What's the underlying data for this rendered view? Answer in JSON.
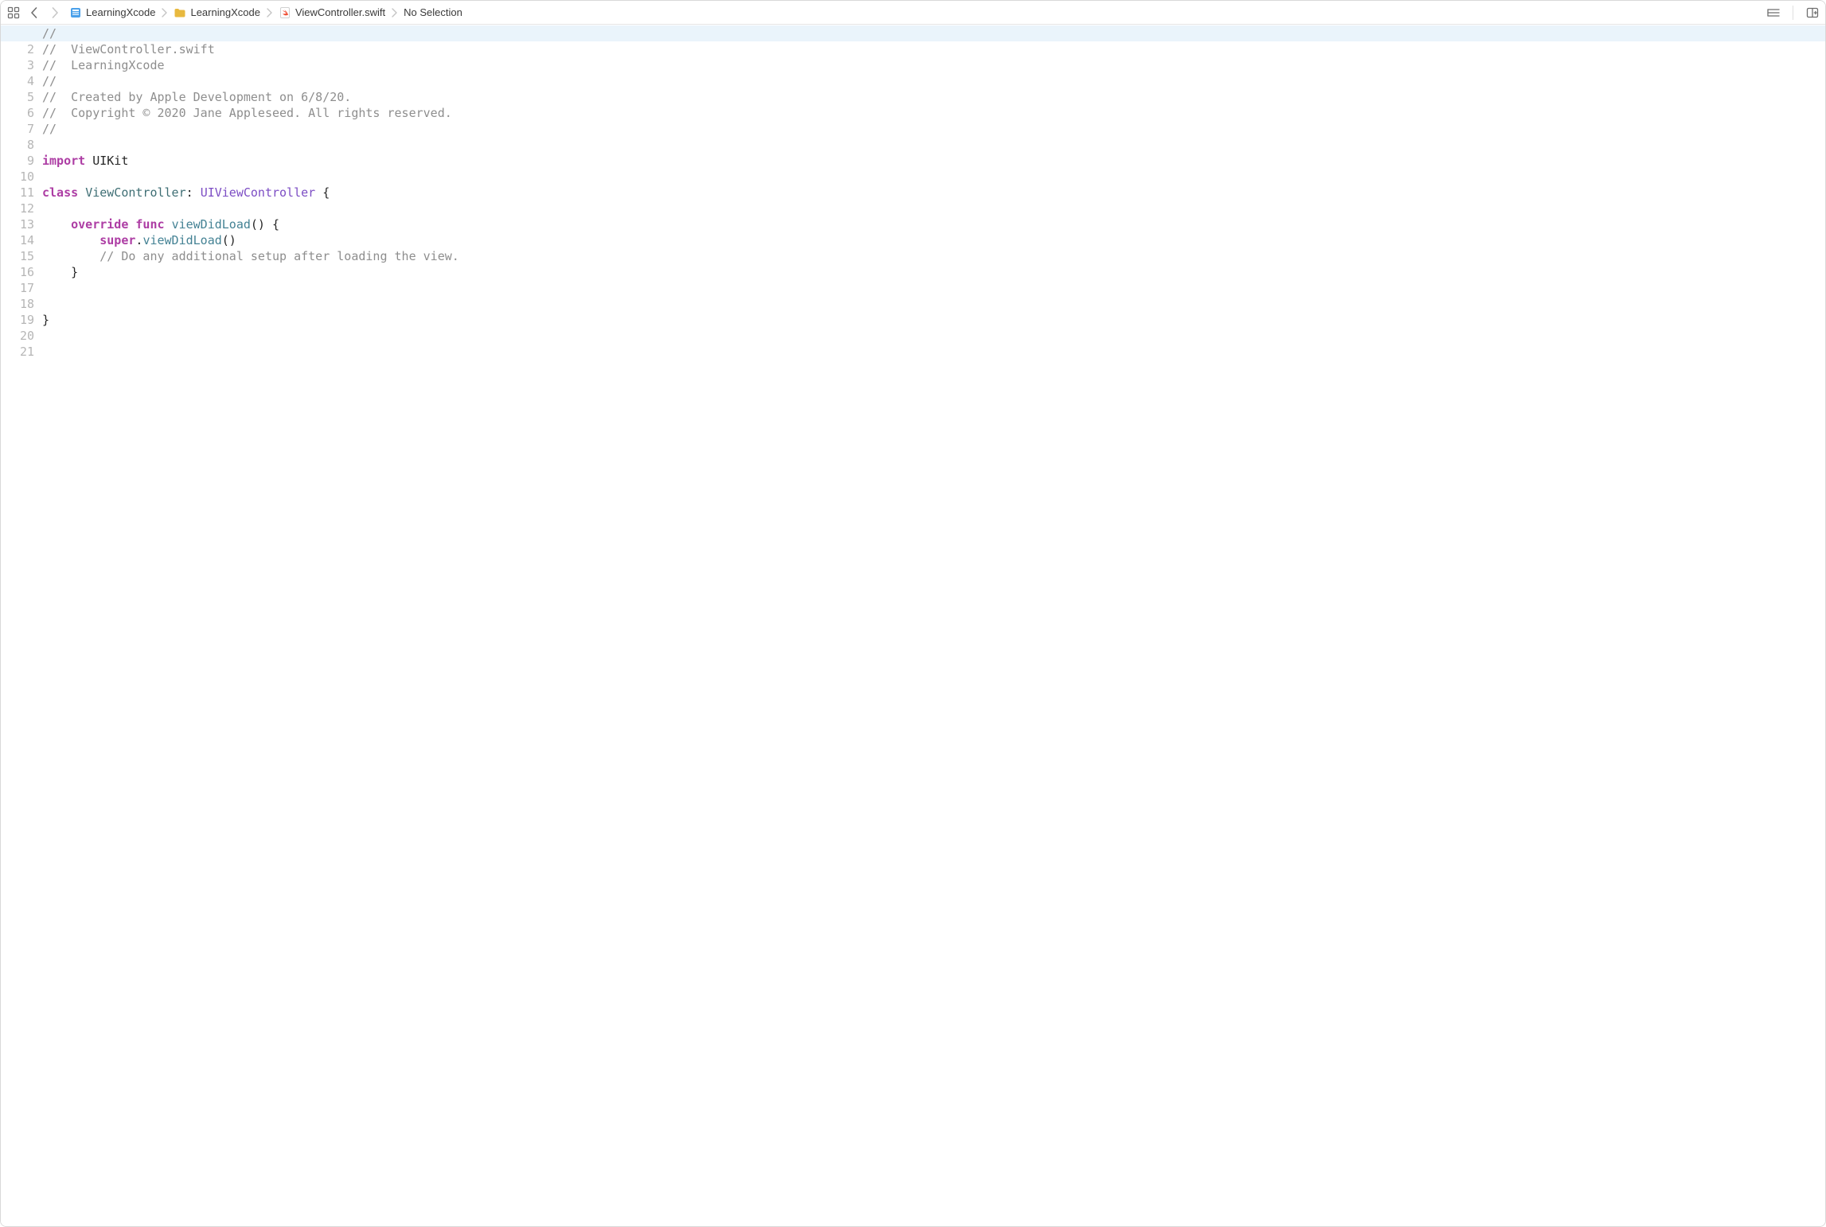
{
  "breadcrumb": {
    "project": "LearningXcode",
    "group": "LearningXcode",
    "file": "ViewController.swift",
    "selection": "No Selection"
  },
  "code_lines": [
    {
      "n": 1,
      "kind": "comment",
      "text": "//"
    },
    {
      "n": 2,
      "kind": "comment",
      "text": "//  ViewController.swift"
    },
    {
      "n": 3,
      "kind": "comment",
      "text": "//  LearningXcode"
    },
    {
      "n": 4,
      "kind": "comment",
      "text": "//"
    },
    {
      "n": 5,
      "kind": "comment",
      "text": "//  Created by Apple Development on 6/8/20."
    },
    {
      "n": 6,
      "kind": "comment",
      "text": "//  Copyright © 2020 Jane Appleseed. All rights reserved."
    },
    {
      "n": 7,
      "kind": "comment",
      "text": "//"
    },
    {
      "n": 8,
      "kind": "blank",
      "text": ""
    },
    {
      "n": 9,
      "kind": "import",
      "keyword": "import",
      "module": "UIKit"
    },
    {
      "n": 10,
      "kind": "blank",
      "text": ""
    },
    {
      "n": 11,
      "kind": "classdecl",
      "keyword": "class",
      "name": "ViewController",
      "colon": ": ",
      "super": "UIViewController",
      "trail": " {"
    },
    {
      "n": 12,
      "kind": "blank",
      "text": ""
    },
    {
      "n": 13,
      "kind": "funcdecl",
      "indent": "    ",
      "kw1": "override",
      "kw2": "func",
      "name": "viewDidLoad",
      "params": "()",
      "trail": " {"
    },
    {
      "n": 14,
      "kind": "supercall",
      "indent": "        ",
      "self": "super",
      "dot": ".",
      "call": "viewDidLoad",
      "paren": "()"
    },
    {
      "n": 15,
      "kind": "comment",
      "indent": "        ",
      "text": "// Do any additional setup after loading the view."
    },
    {
      "n": 16,
      "kind": "plain",
      "text": "    }"
    },
    {
      "n": 17,
      "kind": "blank",
      "text": ""
    },
    {
      "n": 18,
      "kind": "blank",
      "text": ""
    },
    {
      "n": 19,
      "kind": "plain",
      "text": "}"
    },
    {
      "n": 20,
      "kind": "blank",
      "text": ""
    },
    {
      "n": 21,
      "kind": "blank",
      "text": ""
    }
  ],
  "current_line": 1
}
